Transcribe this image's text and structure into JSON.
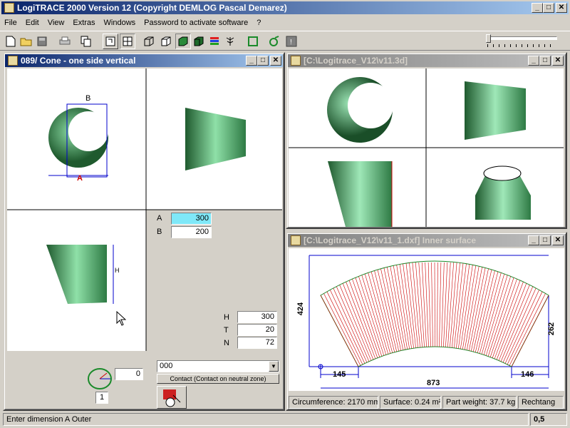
{
  "app": {
    "title": "LogiTRACE 2000  Version 12  (Copyright DEMLOG Pascal Demarez)"
  },
  "menu": [
    "File",
    "Edit",
    "View",
    "Extras",
    "Windows",
    "Password to activate software",
    "?"
  ],
  "window1": {
    "title": "089/ Cone - one side vertical",
    "dim_b_label": "B",
    "dim_a_label": "A",
    "dim_h_label": "H",
    "inputs": [
      {
        "label": "A",
        "value": "300"
      },
      {
        "label": "B",
        "value": "200"
      }
    ],
    "lower_inputs": [
      {
        "label": "H",
        "value": "300"
      },
      {
        "label": "T",
        "value": "20"
      },
      {
        "label": "N",
        "value": "72"
      }
    ],
    "angle_value": "0",
    "count_value": "1",
    "combo_value": "000",
    "contact_button": "Contact (Contact on neutral zone)"
  },
  "window2": {
    "title": "[C:\\Logitrace_V12\\v11.3d]"
  },
  "window3": {
    "title": "[C:\\Logitrace_V12\\v11_1.dxf]  Inner surface",
    "dims": {
      "height_left": "424",
      "height_right": "262",
      "bottom_left": "145",
      "bottom_right": "146",
      "total": "873"
    },
    "status": [
      "Circumference: 2170 mm",
      "Surface: 0.24 m²",
      "Part weight: 37.7 kg",
      "Rechtang"
    ]
  },
  "statusbar": {
    "message": "Enter dimension A Outer",
    "value": "0,5"
  },
  "colors": {
    "active_title": "#0a246a",
    "cone": "#5fb27a",
    "highlight_field": "#7fe8f8",
    "dim_line": "#0000cc",
    "hatch": "#cc0000"
  }
}
